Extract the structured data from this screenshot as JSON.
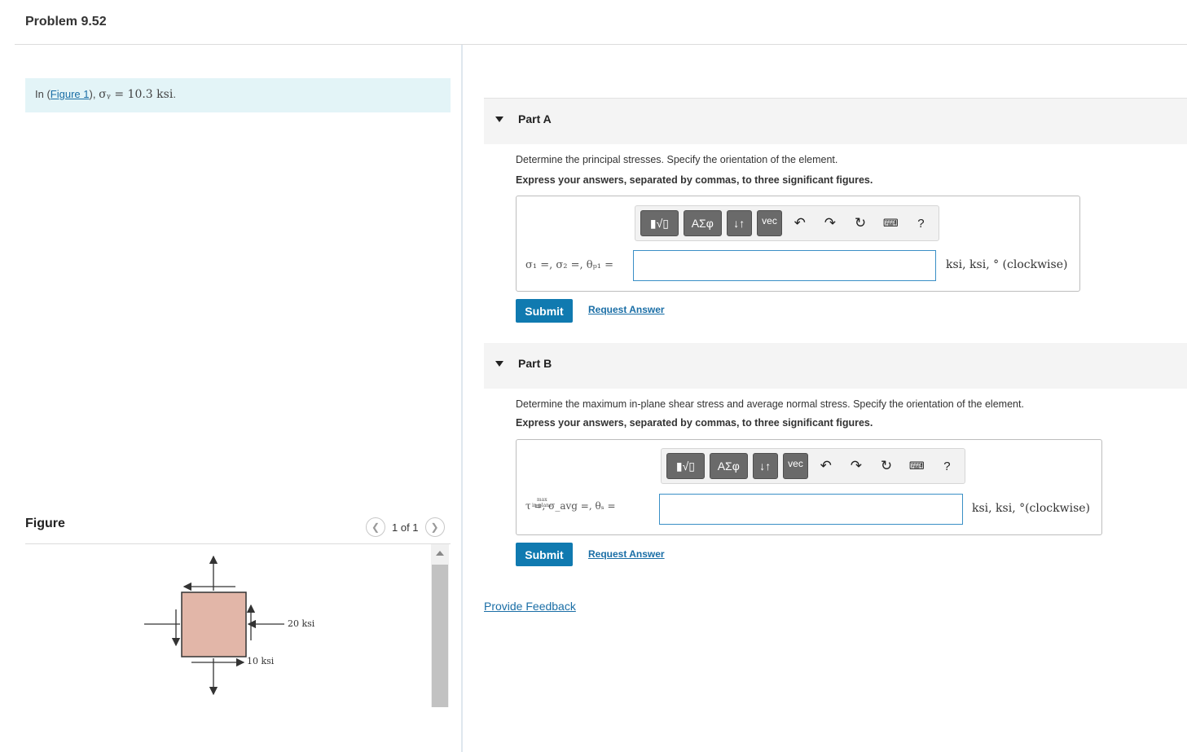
{
  "page": {
    "title": "Problem 9.52"
  },
  "intro": {
    "prefix": "In (",
    "figure_link": "Figure 1",
    "suffix": "),",
    "math": "σᵧ = 10.3 ksi",
    "end": "."
  },
  "figure": {
    "label": "Figure",
    "pager": {
      "prev_icon": "chevron-left-icon",
      "text": "1 of 1",
      "next_icon": "chevron-right-icon"
    },
    "labels": {
      "right": "20 ksi",
      "bottom": "10 ksi"
    },
    "colors": {
      "element_fill": "#e2b6a8",
      "stroke": "#333333"
    }
  },
  "parts": [
    {
      "title": "Part A",
      "question": "Determine the principal stresses. Specify the orientation of the element.",
      "instruction": "Express your answers, separated by commas, to three significant figures.",
      "answer_label": "σ₁ =, σ₂ =, θₚ₁ =",
      "answer_value": "",
      "units": "ksi,  ksi,  ° (clockwise)",
      "submit": "Submit",
      "request": "Request Answer"
    },
    {
      "title": "Part B",
      "question": "Determine the maximum in-plane shear stress and average normal stress. Specify the orientation of the element.",
      "instruction": "Express your answers, separated by commas, to three significant figures.",
      "answer_label": "τ =, σ_avg =, θₛ =",
      "tau_sub_top": "max",
      "tau_sub_bottom": "in-plane",
      "answer_value": "",
      "units": "ksi,  ksi,  °(clockwise)",
      "submit": "Submit",
      "request": "Request Answer"
    }
  ],
  "toolbar": {
    "templates_label": "▮√▯",
    "greek_label": "ΑΣφ",
    "arrows_label": "↓↑",
    "vec_label": "vec",
    "undo_icon": "undo-icon",
    "redo_icon": "redo-icon",
    "reset_icon": "reset-icon",
    "keyboard_icon": "keyboard-icon",
    "help_label": "?"
  },
  "feedback": {
    "label": "Provide Feedback"
  }
}
